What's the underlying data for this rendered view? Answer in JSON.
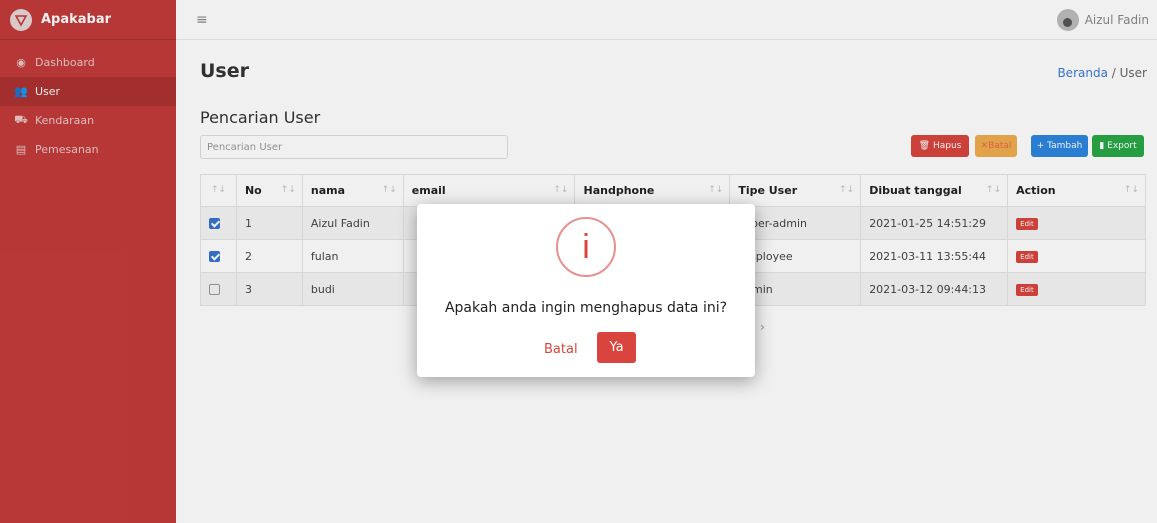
{
  "brand": {
    "name": "Apakabar",
    "color": "#c33b3b"
  },
  "sidebar": {
    "items": [
      {
        "label": "Dashboard",
        "icon": "dashboard-icon"
      },
      {
        "label": "User",
        "icon": "users-icon",
        "active": true
      },
      {
        "label": "Kendaraan",
        "icon": "car-icon"
      },
      {
        "label": "Pemesanan",
        "icon": "clipboard-icon"
      }
    ]
  },
  "topbar": {
    "menu_icon": "hamburger-icon",
    "user_name": "Aizul Fadin"
  },
  "page": {
    "title": "User"
  },
  "breadcrumb": {
    "home": "Beranda",
    "separator": "/",
    "current": "User"
  },
  "search": {
    "title": "Pencarian User",
    "placeholder": "Pencarian User"
  },
  "toolbar": {
    "hapus_label": "Hapus",
    "batal_label": "Batal",
    "tambah_label": "Tambah",
    "export_label": "Export"
  },
  "table": {
    "headers": [
      "",
      "No",
      "nama",
      "email",
      "Handphone",
      "Tipe User",
      "Dibuat tanggal",
      "Action"
    ],
    "rows": [
      {
        "checked": true,
        "no": "1",
        "nama": "Aizul Fadin",
        "email": "",
        "handphone": "",
        "tipe": "super-admin",
        "dibuat": "2021-01-25 14:51:29",
        "action": "Edit"
      },
      {
        "checked": true,
        "no": "2",
        "nama": "fulan",
        "email": "",
        "handphone": "",
        "tipe": "employee",
        "dibuat": "2021-03-11 13:55:44",
        "action": "Edit"
      },
      {
        "checked": false,
        "no": "3",
        "nama": "budi",
        "email": "",
        "handphone": "",
        "tipe": "admin",
        "dibuat": "2021-03-12 09:44:13",
        "action": "Edit"
      }
    ]
  },
  "modal": {
    "icon": "info-icon",
    "icon_glyph": "i",
    "message": "Apakah anda ingin menghapus data ini?",
    "cancel_label": "Batal",
    "confirm_label": "Ya"
  },
  "pager_hint": "›"
}
